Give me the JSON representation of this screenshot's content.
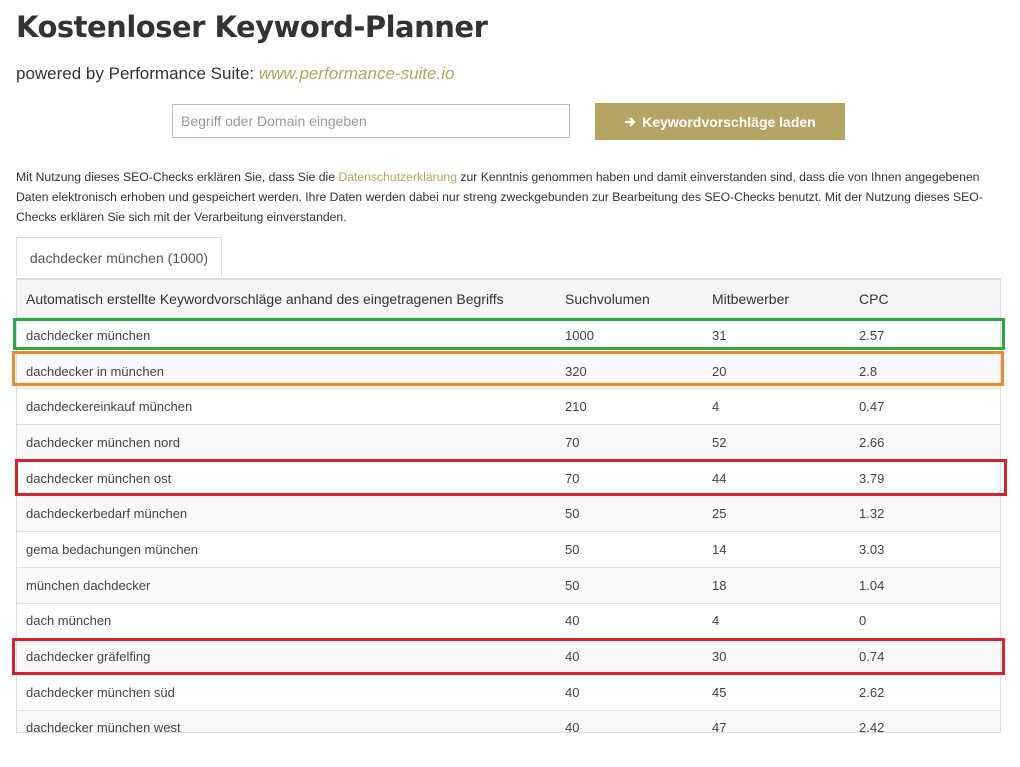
{
  "header": {
    "title": "Kostenloser Keyword-Planner",
    "subtitle_prefix": "powered by Performance Suite:",
    "subtitle_link": "www.performance-suite.io"
  },
  "search": {
    "placeholder": "Begriff oder Domain eingeben",
    "button_label": "Keywordvorschläge laden"
  },
  "disclaimer": {
    "part1": "Mit Nutzung dieses SEO-Checks erklären Sie, dass Sie die ",
    "link": "Datenschutzerklärung",
    "part2": " zur Kenntnis genommen haben und damit einverstanden sind, dass die von Ihnen angegebenen Daten elektronisch erhoben und gespeichert werden. Ihre Daten werden dabei nur streng zweckgebunden zur Bearbeitung des SEO-Checks benutzt. Mit der Nutzung dieses SEO-Checks erklären Sie sich mit der Verarbeitung einverstanden."
  },
  "tab": {
    "label": "dachdecker münchen (1000)"
  },
  "table": {
    "headers": [
      "Automatisch erstellte Keywordvorschläge anhand des eingetragenen Begriffs",
      "Suchvolumen",
      "Mitbewerber",
      "CPC"
    ],
    "rows": [
      [
        "dachdecker münchen",
        "1000",
        "31",
        "2.57"
      ],
      [
        "dachdecker in münchen",
        "320",
        "20",
        "2.8"
      ],
      [
        "dachdeckereinkauf münchen",
        "210",
        "4",
        "0.47"
      ],
      [
        "dachdecker münchen nord",
        "70",
        "52",
        "2.66"
      ],
      [
        "dachdecker münchen ost",
        "70",
        "44",
        "3.79"
      ],
      [
        "dachdeckerbedarf münchen",
        "50",
        "25",
        "1.32"
      ],
      [
        "gema bedachungen münchen",
        "50",
        "14",
        "3.03"
      ],
      [
        "münchen dachdecker",
        "50",
        "18",
        "1.04"
      ],
      [
        "dach münchen",
        "40",
        "4",
        "0"
      ],
      [
        "dachdecker gräfelfing",
        "40",
        "30",
        "0.74"
      ],
      [
        "dachdecker münchen süd",
        "40",
        "45",
        "2.62"
      ],
      [
        "dachdecker münchen west",
        "40",
        "47",
        "2.42"
      ]
    ]
  },
  "colors": {
    "accent": "#b5a565",
    "highlight_green": "#2aa845",
    "highlight_orange": "#f08a2c",
    "highlight_red": "#d9222a"
  },
  "icons": {
    "button_icon": "arrow-right-icon"
  }
}
